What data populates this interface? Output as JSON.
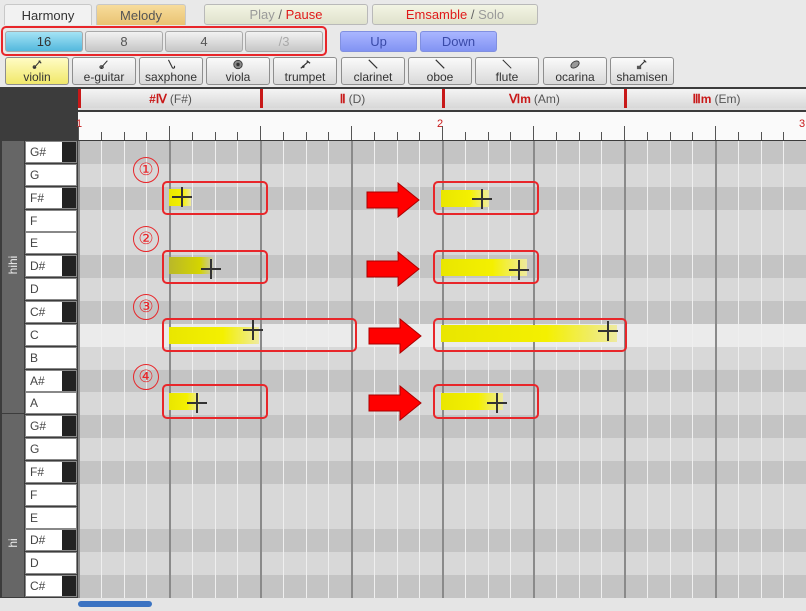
{
  "tabs": {
    "harmony": "Harmony",
    "melody": "Melody"
  },
  "transport": {
    "play": "Play",
    "slash1": "/",
    "pause": "Pause",
    "ensemble": "Emsamble",
    "slash2": "/",
    "solo": "Solo"
  },
  "note_lengths": [
    "16",
    "8",
    "4",
    "/3"
  ],
  "octave": {
    "up": "Up",
    "down": "Down"
  },
  "instruments": [
    {
      "label": "violin",
      "icon": "violin-icon"
    },
    {
      "label": "e-guitar",
      "icon": "e-guitar-icon"
    },
    {
      "label": "saxphone",
      "icon": "saxphone-icon"
    },
    {
      "label": "viola",
      "icon": "viola-icon"
    },
    {
      "label": "trumpet",
      "icon": "trumpet-icon"
    },
    {
      "label": "clarinet",
      "icon": "clarinet-icon"
    },
    {
      "label": "oboe",
      "icon": "oboe-icon"
    },
    {
      "label": "flute",
      "icon": "flute-icon"
    },
    {
      "label": "ocarina",
      "icon": "ocarina-icon"
    },
    {
      "label": "shamisen",
      "icon": "shamisen-icon"
    }
  ],
  "chords": [
    {
      "roman": "#Ⅳ",
      "name": "(F#)"
    },
    {
      "roman": "Ⅱ",
      "name": "(D)"
    },
    {
      "roman": "Ⅵm",
      "name": "(Am)"
    },
    {
      "roman": "Ⅲm",
      "name": "(Em)"
    }
  ],
  "ruler": {
    "m1": "1",
    "m2": "2",
    "m3": "3"
  },
  "octave_labels": {
    "hihi": "hihi",
    "hi": "hi"
  },
  "keys": [
    "G#",
    "G",
    "F#",
    "F",
    "E",
    "D#",
    "D",
    "C#",
    "C",
    "B",
    "A#",
    "A",
    "G#",
    "G",
    "F#",
    "F",
    "E",
    "D#",
    "D",
    "C#"
  ],
  "steps": [
    "①",
    "②",
    "③",
    "④"
  ],
  "colors": {
    "accent_red": "#e8262a",
    "note_yellow": "#f4f000",
    "selected_len": "#53b8dd"
  }
}
